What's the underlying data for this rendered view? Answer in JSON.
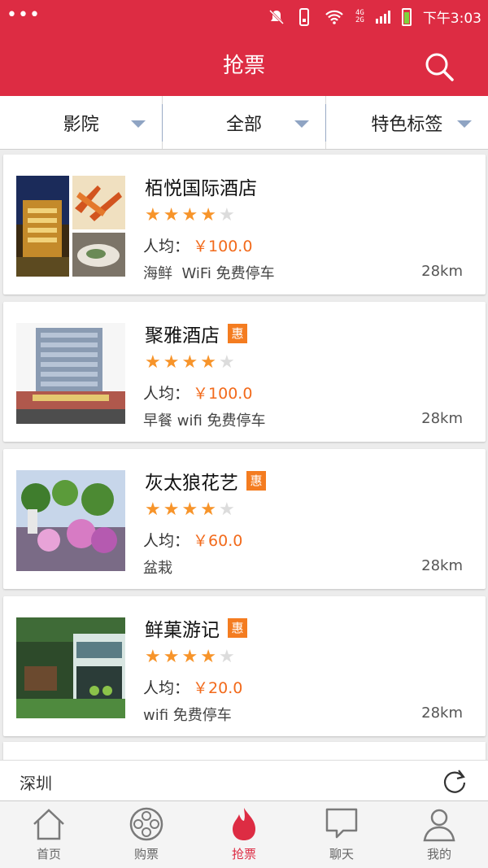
{
  "status_bar": {
    "menu_dots": "•••",
    "network": "4G\n2G",
    "time": "下午3:03"
  },
  "header": {
    "title": "抢票"
  },
  "filters": [
    {
      "label": "影院"
    },
    {
      "label": "全部"
    },
    {
      "label": "特色标签"
    }
  ],
  "list": [
    {
      "name": "栢悦国际酒店",
      "badge": "",
      "rating": 4,
      "max_rating": 5,
      "price_label": "人均：",
      "price": "￥100.0",
      "tags": "海鲜  WiFi 免费停车",
      "distance": "28km"
    },
    {
      "name": "聚雅酒店",
      "badge": "惠",
      "rating": 4,
      "max_rating": 5,
      "price_label": "人均：",
      "price": "￥100.0",
      "tags": "早餐 wifi 免费停车",
      "distance": "28km"
    },
    {
      "name": "灰太狼花艺",
      "badge": "惠",
      "rating": 4,
      "max_rating": 5,
      "price_label": "人均：",
      "price": "￥60.0",
      "tags": "盆栽",
      "distance": "28km"
    },
    {
      "name": "鲜菓游记",
      "badge": "惠",
      "rating": 4,
      "max_rating": 5,
      "price_label": "人均：",
      "price": "￥20.0",
      "tags": "wifi 免费停车",
      "distance": "28km"
    }
  ],
  "city_bar": {
    "city": "深圳"
  },
  "bottom_nav": [
    {
      "label": "首页",
      "icon": "home-icon"
    },
    {
      "label": "购票",
      "icon": "film-reel-icon"
    },
    {
      "label": "抢票",
      "icon": "flame-icon",
      "active": true
    },
    {
      "label": "聊天",
      "icon": "chat-bubble-icon"
    },
    {
      "label": "我的",
      "icon": "user-icon"
    }
  ],
  "colors": {
    "brand": "#dd2c43",
    "price": "#f26a1b",
    "badge": "#f47c20",
    "star": "#f7942a"
  }
}
